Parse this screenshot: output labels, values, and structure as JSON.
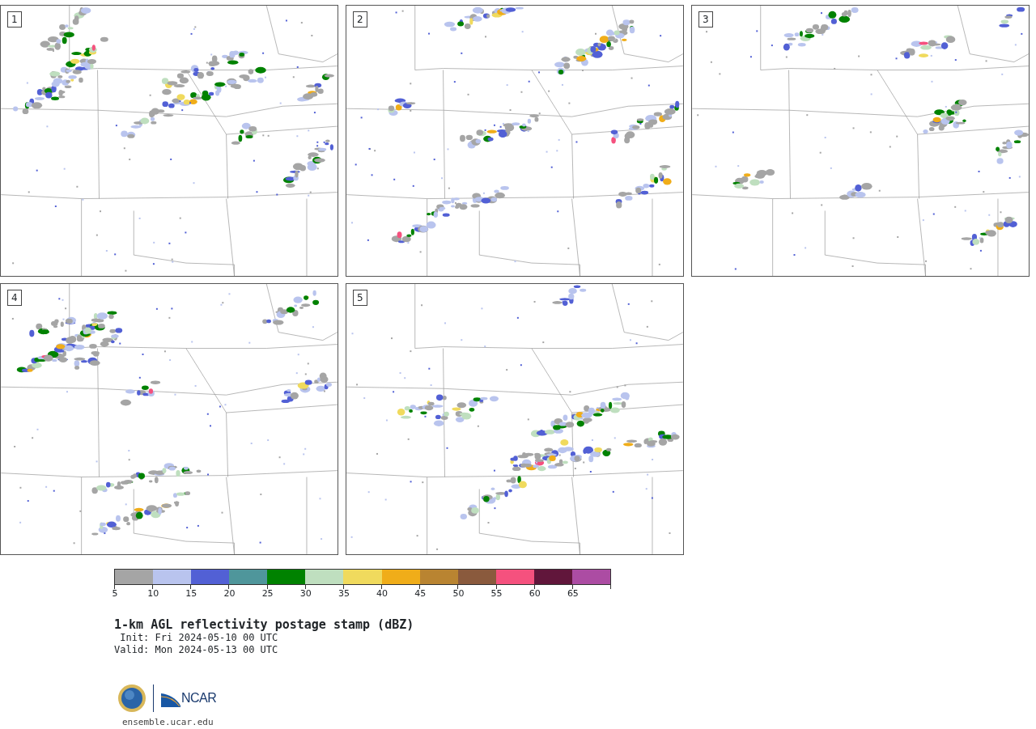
{
  "panels": [
    {
      "number": "1"
    },
    {
      "number": "2"
    },
    {
      "number": "3"
    },
    {
      "number": "4"
    },
    {
      "number": "5"
    }
  ],
  "colorbar": [
    {
      "tick": "5",
      "color": "#a5a5a5"
    },
    {
      "tick": "10",
      "color": "#b9c4ee"
    },
    {
      "tick": "15",
      "color": "#5260d5"
    },
    {
      "tick": "20",
      "color": "#4f969b"
    },
    {
      "tick": "25",
      "color": "#008200"
    },
    {
      "tick": "30",
      "color": "#bfdfbf"
    },
    {
      "tick": "35",
      "color": "#f0da5d"
    },
    {
      "tick": "40",
      "color": "#f0ad19"
    },
    {
      "tick": "45",
      "color": "#b98431"
    },
    {
      "tick": "50",
      "color": "#8a5a3d"
    },
    {
      "tick": "55",
      "color": "#f5517e"
    },
    {
      "tick": "60",
      "color": "#61163b"
    },
    {
      "tick": "65",
      "color": "#ac4ca3"
    }
  ],
  "title": "1-km AGL reflectivity postage stamp (dBZ)",
  "init": " Init: Fri 2024-05-10 00 UTC",
  "valid": "Valid: Mon 2024-05-13 00 UTC",
  "logo": {
    "org": "NCAR"
  },
  "url": "ensemble.ucar.edu"
}
